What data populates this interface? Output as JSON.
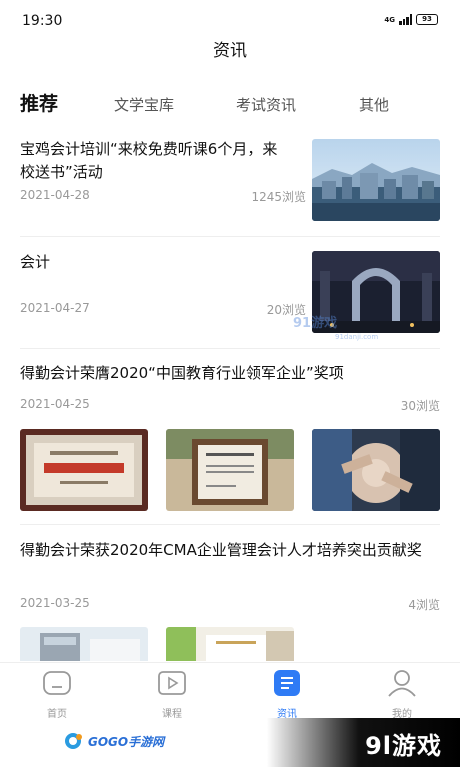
{
  "status_bar": {
    "time": "19:30",
    "network": "4G",
    "battery": "93"
  },
  "header": {
    "title": "资讯"
  },
  "tabs": [
    {
      "label": "推荐",
      "active": true
    },
    {
      "label": "文学宝库",
      "active": false
    },
    {
      "label": "考试资讯",
      "active": false
    },
    {
      "label": "其他",
      "active": false
    }
  ],
  "articles": [
    {
      "title": "宝鸡会计培训“来校免费听课6个月，来校送书”活动",
      "date": "2021-04-28",
      "views": "1245浏览"
    },
    {
      "title": "会计",
      "date": "2021-04-27",
      "views": "20浏览"
    },
    {
      "title": "得勤会计荣膺2020“中国教育行业领军企业”奖项",
      "date": "2021-04-25",
      "views": "30浏览"
    },
    {
      "title": "得勤会计荣获2020年CMA企业管理会计人才培养突出贡献奖",
      "date": "2021-03-25",
      "views": "4浏览"
    }
  ],
  "tabbar": [
    {
      "label": "首页",
      "icon": "home-icon",
      "active": false
    },
    {
      "label": "课程",
      "icon": "play-icon",
      "active": false
    },
    {
      "label": "资讯",
      "icon": "news-icon",
      "active": true
    },
    {
      "label": "我的",
      "icon": "user-icon",
      "active": false
    }
  ],
  "watermarks": {
    "site": "91游戏",
    "site_sub": "91danji.com",
    "gogo": "GOGO手游网",
    "brand": "9l游戏"
  },
  "colors": {
    "accent": "#2f7bf5",
    "text": "#111111",
    "muted": "#999999"
  }
}
